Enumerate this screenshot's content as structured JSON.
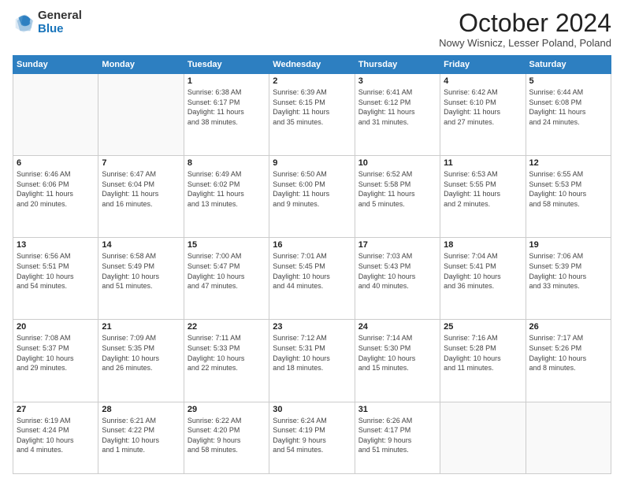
{
  "header": {
    "logo_general": "General",
    "logo_blue": "Blue",
    "month_title": "October 2024",
    "location": "Nowy Wisnicz, Lesser Poland, Poland"
  },
  "days_of_week": [
    "Sunday",
    "Monday",
    "Tuesday",
    "Wednesday",
    "Thursday",
    "Friday",
    "Saturday"
  ],
  "weeks": [
    [
      {
        "day": "",
        "info": ""
      },
      {
        "day": "",
        "info": ""
      },
      {
        "day": "1",
        "info": "Sunrise: 6:38 AM\nSunset: 6:17 PM\nDaylight: 11 hours\nand 38 minutes."
      },
      {
        "day": "2",
        "info": "Sunrise: 6:39 AM\nSunset: 6:15 PM\nDaylight: 11 hours\nand 35 minutes."
      },
      {
        "day": "3",
        "info": "Sunrise: 6:41 AM\nSunset: 6:12 PM\nDaylight: 11 hours\nand 31 minutes."
      },
      {
        "day": "4",
        "info": "Sunrise: 6:42 AM\nSunset: 6:10 PM\nDaylight: 11 hours\nand 27 minutes."
      },
      {
        "day": "5",
        "info": "Sunrise: 6:44 AM\nSunset: 6:08 PM\nDaylight: 11 hours\nand 24 minutes."
      }
    ],
    [
      {
        "day": "6",
        "info": "Sunrise: 6:46 AM\nSunset: 6:06 PM\nDaylight: 11 hours\nand 20 minutes."
      },
      {
        "day": "7",
        "info": "Sunrise: 6:47 AM\nSunset: 6:04 PM\nDaylight: 11 hours\nand 16 minutes."
      },
      {
        "day": "8",
        "info": "Sunrise: 6:49 AM\nSunset: 6:02 PM\nDaylight: 11 hours\nand 13 minutes."
      },
      {
        "day": "9",
        "info": "Sunrise: 6:50 AM\nSunset: 6:00 PM\nDaylight: 11 hours\nand 9 minutes."
      },
      {
        "day": "10",
        "info": "Sunrise: 6:52 AM\nSunset: 5:58 PM\nDaylight: 11 hours\nand 5 minutes."
      },
      {
        "day": "11",
        "info": "Sunrise: 6:53 AM\nSunset: 5:55 PM\nDaylight: 11 hours\nand 2 minutes."
      },
      {
        "day": "12",
        "info": "Sunrise: 6:55 AM\nSunset: 5:53 PM\nDaylight: 10 hours\nand 58 minutes."
      }
    ],
    [
      {
        "day": "13",
        "info": "Sunrise: 6:56 AM\nSunset: 5:51 PM\nDaylight: 10 hours\nand 54 minutes."
      },
      {
        "day": "14",
        "info": "Sunrise: 6:58 AM\nSunset: 5:49 PM\nDaylight: 10 hours\nand 51 minutes."
      },
      {
        "day": "15",
        "info": "Sunrise: 7:00 AM\nSunset: 5:47 PM\nDaylight: 10 hours\nand 47 minutes."
      },
      {
        "day": "16",
        "info": "Sunrise: 7:01 AM\nSunset: 5:45 PM\nDaylight: 10 hours\nand 44 minutes."
      },
      {
        "day": "17",
        "info": "Sunrise: 7:03 AM\nSunset: 5:43 PM\nDaylight: 10 hours\nand 40 minutes."
      },
      {
        "day": "18",
        "info": "Sunrise: 7:04 AM\nSunset: 5:41 PM\nDaylight: 10 hours\nand 36 minutes."
      },
      {
        "day": "19",
        "info": "Sunrise: 7:06 AM\nSunset: 5:39 PM\nDaylight: 10 hours\nand 33 minutes."
      }
    ],
    [
      {
        "day": "20",
        "info": "Sunrise: 7:08 AM\nSunset: 5:37 PM\nDaylight: 10 hours\nand 29 minutes."
      },
      {
        "day": "21",
        "info": "Sunrise: 7:09 AM\nSunset: 5:35 PM\nDaylight: 10 hours\nand 26 minutes."
      },
      {
        "day": "22",
        "info": "Sunrise: 7:11 AM\nSunset: 5:33 PM\nDaylight: 10 hours\nand 22 minutes."
      },
      {
        "day": "23",
        "info": "Sunrise: 7:12 AM\nSunset: 5:31 PM\nDaylight: 10 hours\nand 18 minutes."
      },
      {
        "day": "24",
        "info": "Sunrise: 7:14 AM\nSunset: 5:30 PM\nDaylight: 10 hours\nand 15 minutes."
      },
      {
        "day": "25",
        "info": "Sunrise: 7:16 AM\nSunset: 5:28 PM\nDaylight: 10 hours\nand 11 minutes."
      },
      {
        "day": "26",
        "info": "Sunrise: 7:17 AM\nSunset: 5:26 PM\nDaylight: 10 hours\nand 8 minutes."
      }
    ],
    [
      {
        "day": "27",
        "info": "Sunrise: 6:19 AM\nSunset: 4:24 PM\nDaylight: 10 hours\nand 4 minutes."
      },
      {
        "day": "28",
        "info": "Sunrise: 6:21 AM\nSunset: 4:22 PM\nDaylight: 10 hours\nand 1 minute."
      },
      {
        "day": "29",
        "info": "Sunrise: 6:22 AM\nSunset: 4:20 PM\nDaylight: 9 hours\nand 58 minutes."
      },
      {
        "day": "30",
        "info": "Sunrise: 6:24 AM\nSunset: 4:19 PM\nDaylight: 9 hours\nand 54 minutes."
      },
      {
        "day": "31",
        "info": "Sunrise: 6:26 AM\nSunset: 4:17 PM\nDaylight: 9 hours\nand 51 minutes."
      },
      {
        "day": "",
        "info": ""
      },
      {
        "day": "",
        "info": ""
      }
    ]
  ]
}
